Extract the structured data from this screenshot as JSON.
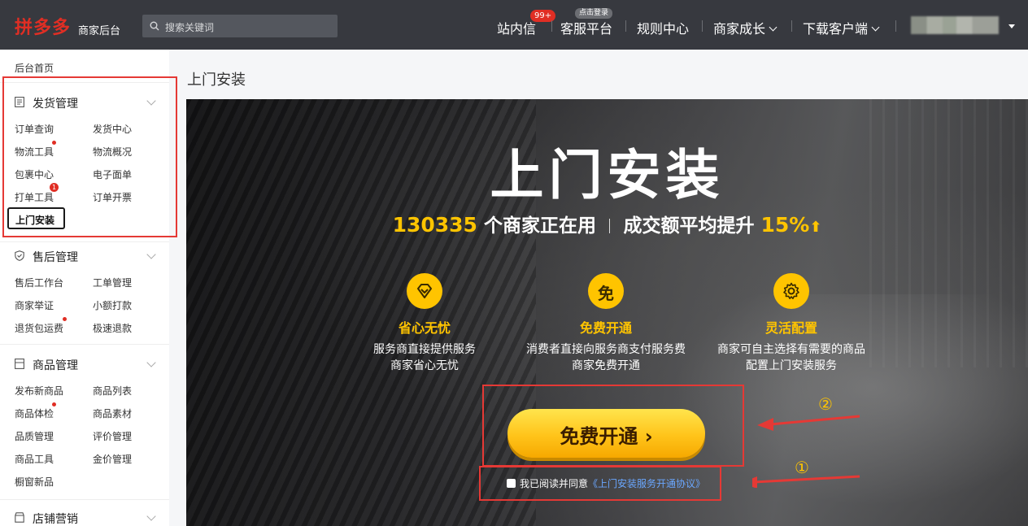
{
  "topbar": {
    "logo": "拼多多",
    "logo_sub": "商家后台",
    "search_placeholder": "搜索关键词",
    "nav": {
      "messages": "站内信",
      "messages_badge": "99+",
      "service": "客服平台",
      "service_tag": "点击登录",
      "rules": "规则中心",
      "growth": "商家成长",
      "download": "下载客户端"
    }
  },
  "sidebar": {
    "home": "后台首页",
    "shipping": {
      "title": "发货管理",
      "items": [
        "订单查询",
        "发货中心",
        "物流工具",
        "物流概况",
        "包裹中心",
        "电子面单",
        "打单工具",
        "订单开票",
        "上门安装"
      ],
      "badge": "1"
    },
    "aftersale": {
      "title": "售后管理",
      "items": [
        "售后工作台",
        "工单管理",
        "商家举证",
        "小额打款",
        "退货包运费",
        "极速退款"
      ]
    },
    "goods": {
      "title": "商品管理",
      "items": [
        "发布新商品",
        "商品列表",
        "商品体检",
        "商品素材",
        "品质管理",
        "评价管理",
        "商品工具",
        "金价管理",
        "橱窗新品"
      ]
    },
    "marketing": {
      "title": "店铺营销"
    }
  },
  "main": {
    "page_title": "上门安装",
    "hero": {
      "title": "上门安装",
      "stat_count": "130335",
      "stat_count_suffix": " 个商家正在用",
      "stat_growth_prefix": "成交额平均提升 ",
      "stat_growth_value": "15%",
      "stat_arrow": "⬆",
      "features": [
        {
          "name": "省心无忧",
          "desc": "服务商直接提供服务\n商家省心无忧",
          "icon": "diamond-icon"
        },
        {
          "name": "免费开通",
          "desc": "消费者直接向服务商支付服务费\n商家免费开通",
          "icon": "free-icon",
          "glyph": "免"
        },
        {
          "name": "灵活配置",
          "desc": "商家可自主选择有需要的商品\n配置上门安装服务",
          "icon": "gear-icon"
        }
      ],
      "cta": "免费开通 ›",
      "agree_text": "我已阅读并同意",
      "agree_link": "《上门安装服务开通协议》"
    },
    "annotations": {
      "one": "①",
      "two": "②"
    }
  },
  "colors": {
    "accent": "#ffc400",
    "brand": "#e02e24",
    "annotation": "#e53935"
  }
}
